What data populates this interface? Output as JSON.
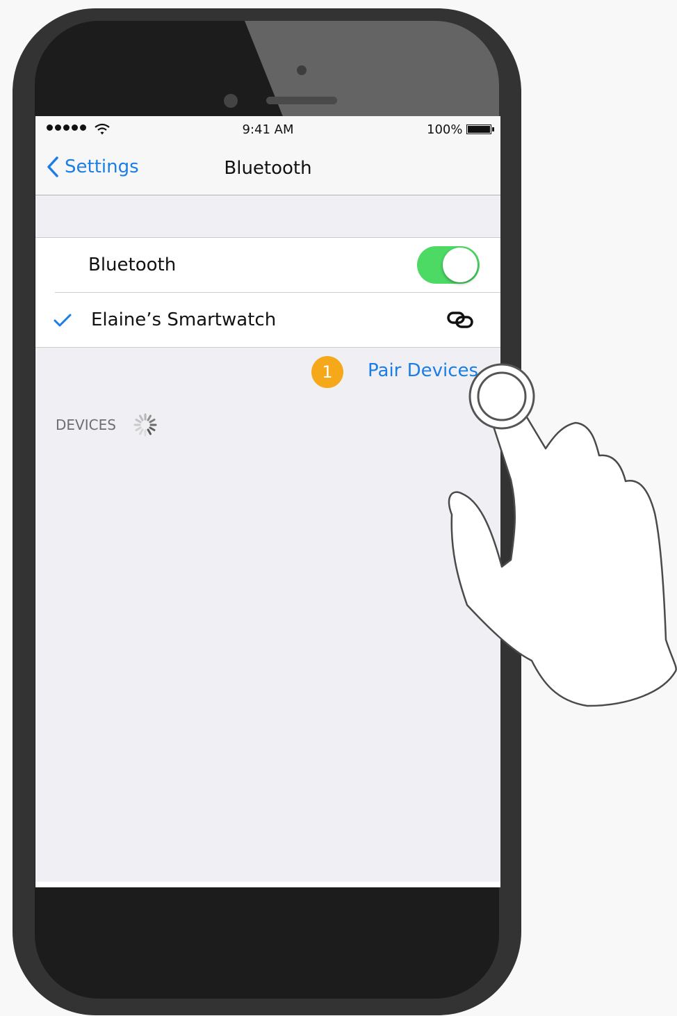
{
  "status_bar": {
    "time": "9:41 AM",
    "battery_percent": "100%",
    "signal_bars": 5
  },
  "nav": {
    "back_label": "Settings",
    "title": "Bluetooth"
  },
  "bluetooth_row": {
    "label": "Bluetooth",
    "enabled": true
  },
  "device_row": {
    "label": "Elaine’s Smartwatch",
    "connected": true
  },
  "step_badge": "1",
  "pair_devices_label": "Pair Devices",
  "devices_header": "DEVICES",
  "colors": {
    "accent": "#1a7ee6",
    "toggle_on": "#4cd964",
    "badge": "#f5a91a",
    "background": "#efeff4"
  },
  "icons": {
    "back": "chevron-left-icon",
    "checkmark": "checkmark-icon",
    "link": "link-icon",
    "spinner": "activity-spinner-icon",
    "wifi": "wifi-icon",
    "battery": "battery-icon",
    "hand": "hand-pointer-icon"
  }
}
